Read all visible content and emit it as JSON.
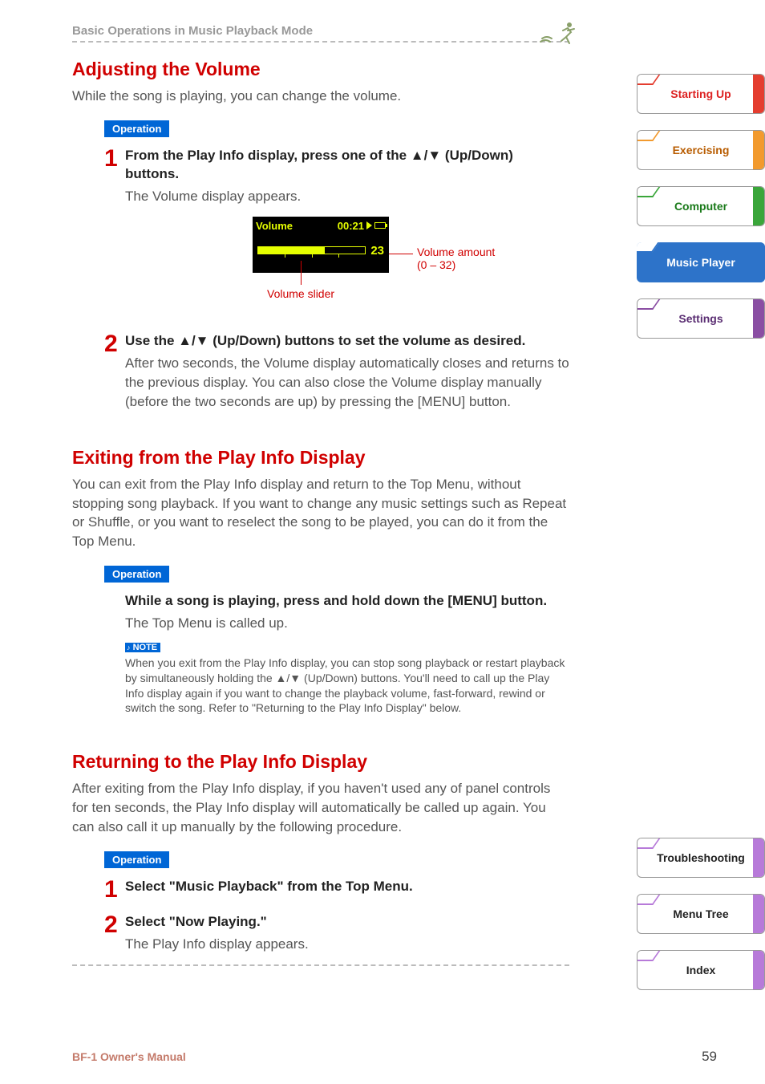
{
  "header": {
    "breadcrumb": "Basic Operations in Music Playback Mode"
  },
  "sections": {
    "volume": {
      "title": "Adjusting the Volume",
      "intro": "While the song is playing, you can change the volume.",
      "op_label": "Operation",
      "step1_num": "1",
      "step1_title": "From the Play Info display, press one of the ▲/▼ (Up/Down) buttons.",
      "step1_desc": "The Volume display appears.",
      "step2_num": "2",
      "step2_title": "Use the ▲/▼ (Up/Down) buttons to set the volume as desired.",
      "step2_desc": "After two seconds, the Volume display automatically closes and returns to the previous display. You can also close the Volume display manually (before the two seconds are up) by pressing the [MENU] button."
    },
    "lcd": {
      "title": "Volume",
      "time": "00:21",
      "value": "23",
      "annot_amount": "Volume amount",
      "annot_range": "(0 – 32)",
      "annot_slider": "Volume slider"
    },
    "exit": {
      "title": "Exiting from the Play Info Display",
      "intro": "You can exit from the Play Info display and return to the Top Menu, without stopping song playback. If you want to change any music settings such as Repeat or Shuffle, or you want to reselect the song to be played, you can do it from the Top Menu.",
      "op_label": "Operation",
      "step_title": "While a song is playing, press and hold down the [MENU] button.",
      "step_desc": "The Top Menu is called up.",
      "note_label": "NOTE",
      "note_body": "When you exit from the Play Info display, you can stop song playback or restart playback by simultaneously holding the ▲/▼ (Up/Down) buttons. You'll need to call up the Play Info display again if you want to change the playback volume, fast-forward, rewind or switch the song. Refer to \"Returning to the Play Info Display\" below."
    },
    "return": {
      "title": "Returning to the Play Info Display",
      "intro": "After exiting from the Play Info display, if you haven't used any of panel controls for ten seconds, the Play Info display will automatically be called up again. You can also call it up manually by the following procedure.",
      "op_label": "Operation",
      "step1_num": "1",
      "step1_title": "Select \"Music Playback\" from the Top Menu.",
      "step2_num": "2",
      "step2_title": "Select \"Now Playing.\"",
      "step2_desc": "The Play Info display appears."
    }
  },
  "tabs_top": [
    {
      "label": "Starting Up",
      "color": "#e43d2f",
      "text": "#d22",
      "active": false
    },
    {
      "label": "Exercising",
      "color": "#f29a2e",
      "text": "#b85c00",
      "active": false
    },
    {
      "label": "Computer",
      "color": "#3aa63a",
      "text": "#1a7a1a",
      "active": false
    },
    {
      "label": "Music Player",
      "color": "#2d73c9",
      "text": "#fff",
      "active": true,
      "bg": "#2d73c9"
    },
    {
      "label": "Settings",
      "color": "#8a4ea3",
      "text": "#5a2d72",
      "active": false
    }
  ],
  "tabs_bottom": [
    {
      "label": "Troubleshooting",
      "color": "#b77ad9",
      "text": "#222"
    },
    {
      "label": "Menu Tree",
      "color": "#b77ad9",
      "text": "#222"
    },
    {
      "label": "Index",
      "color": "#b77ad9",
      "text": "#222"
    }
  ],
  "footer": {
    "left": "BF-1 Owner's Manual",
    "page": "59"
  }
}
